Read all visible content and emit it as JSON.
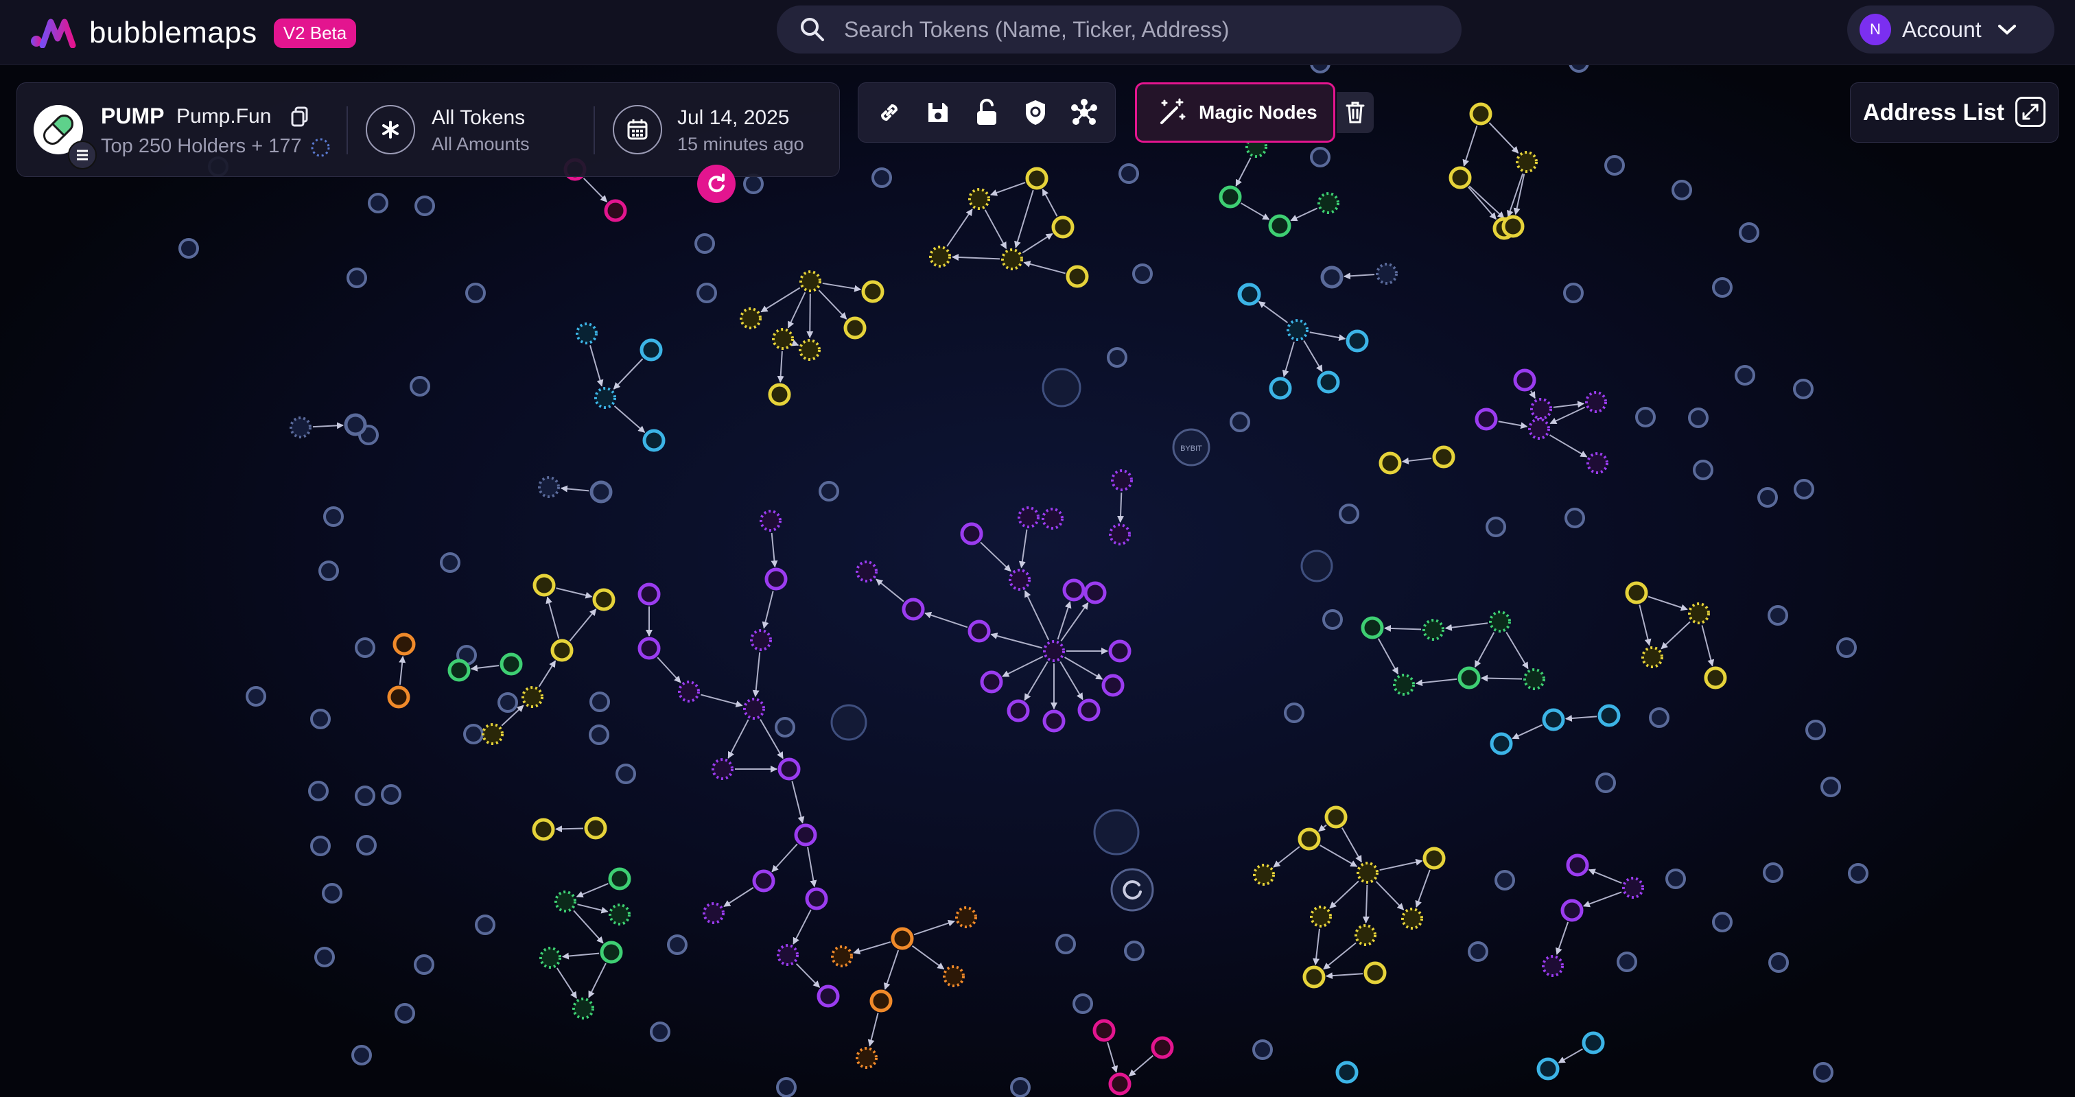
{
  "app": {
    "name": "bubblemaps",
    "badge": "V2 Beta"
  },
  "search": {
    "placeholder": "Search Tokens (Name, Ticker, Address)"
  },
  "account": {
    "initial": "N",
    "label": "Account"
  },
  "token": {
    "ticker": "PUMP",
    "name": "Pump.Fun",
    "holders": "Top 250 Holders + 177",
    "filter_title": "All Tokens",
    "filter_sub": "All Amounts",
    "date": "Jul 14, 2025",
    "date_sub": "15 minutes ago"
  },
  "toolbar": {
    "icons": [
      "link-icon",
      "save-icon",
      "unlock-icon",
      "shield-icon",
      "network-icon"
    ],
    "magic_nodes_label": "Magic Nodes"
  },
  "address_list": {
    "label": "Address List"
  },
  "graph": {
    "tags": {
      "small_bubble": "BYBIT"
    },
    "colors": {
      "yellow": "#e6d33a",
      "purple": "#9b3cf0",
      "green": "#3ecf73",
      "cyan": "#3cb4e6",
      "orange": "#f08a2a",
      "pink": "#e3158f",
      "gray": "#5a6a9a"
    }
  }
}
